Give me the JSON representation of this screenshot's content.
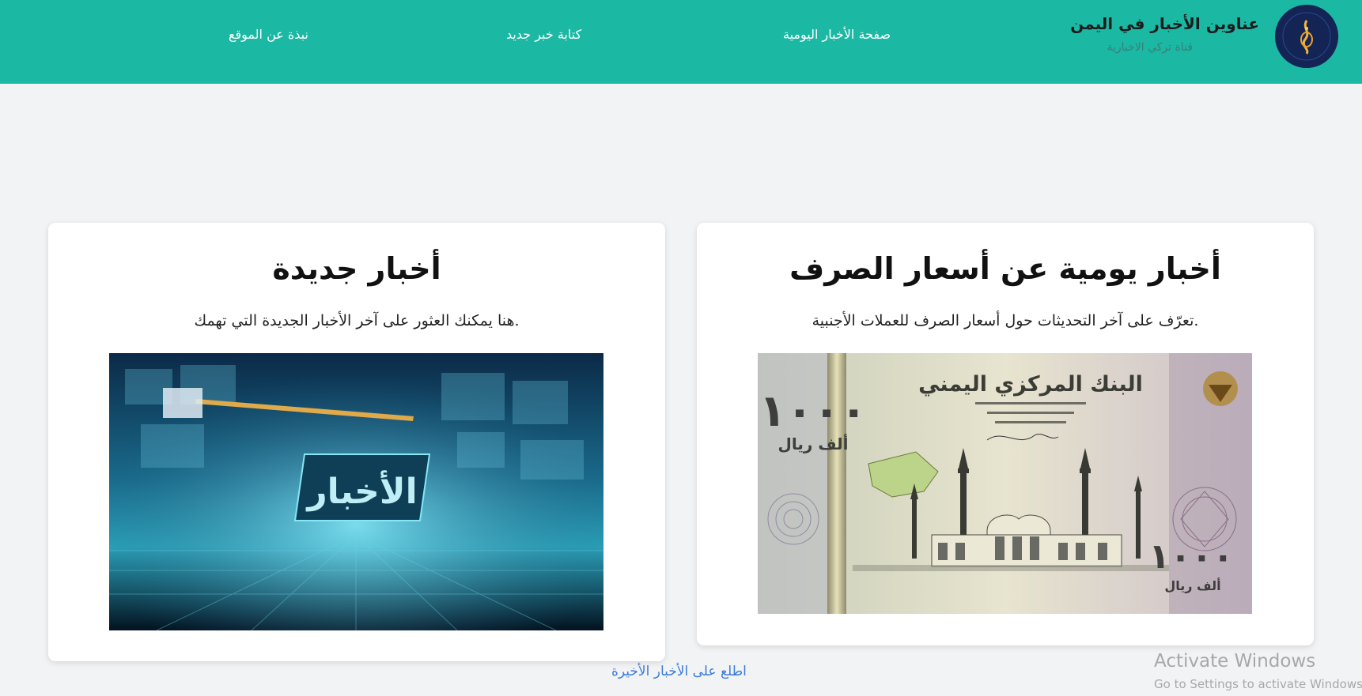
{
  "header": {
    "brand_title": "عناوين الأخبار في اليمن",
    "brand_subtitle": "قناة تركي الاخبارية",
    "nav": [
      "صفحة الأخبار اليومية",
      "كتابة خبر جديد",
      "نبذة عن الموقع"
    ],
    "bg_color": "#1bb8a4"
  },
  "cards": {
    "rates": {
      "title": "أخبار يومية عن أسعار الصرف",
      "description": ".تعرّف على آخر التحديثات حول أسعار الصرف للعملات الأجنبية",
      "image_label": "yemeni-1000-rial-banknote",
      "banknote_text": {
        "bank_name": "البنك المركزي اليمني",
        "denomination": "١٠٠٠",
        "currency": "ألف ريال"
      }
    },
    "news": {
      "title": "أخبار جديدة",
      "description": ".هنا يمكنك العثور على آخر الأخبار الجديدة التي تهمك",
      "image_label": "news-studio-graphic",
      "image_text": "الأخبار"
    }
  },
  "latest_link": "اطلع على الأخبار الأخيرة",
  "windows_watermark": {
    "title": "Activate Windows",
    "subtitle": "Go to Settings to activate Windows."
  }
}
